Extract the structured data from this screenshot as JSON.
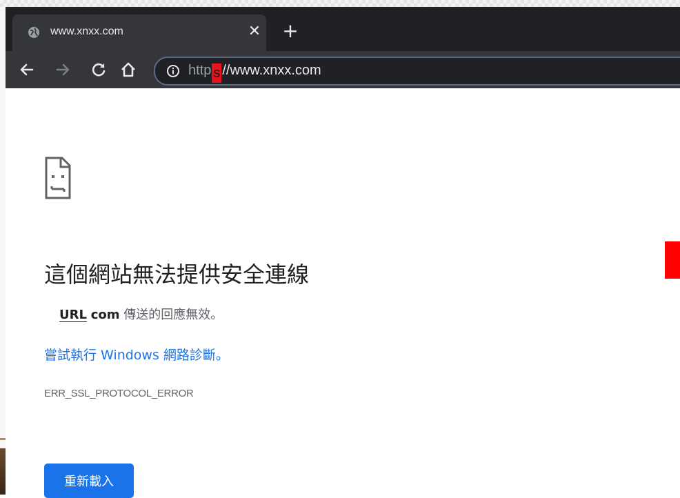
{
  "tab": {
    "title": "www.xnxx.com",
    "close_glyph": "✕",
    "new_tab_glyph": "+",
    "favicon": "globe-icon"
  },
  "toolbar": {
    "back_icon": "back-arrow-icon",
    "forward_icon": "forward-arrow-icon",
    "reload_icon": "reload-icon",
    "home_icon": "home-icon"
  },
  "omnibox": {
    "info_icon": "info-icon",
    "url_scheme_prefix": "http",
    "url_scheme_highlight": "s",
    "url_rest": "//www.xnxx.com",
    "highlight_color": "#e8121b"
  },
  "error_page": {
    "icon": "sad-page-icon",
    "heading": "這個網站無法提供安全連線",
    "sub_url_label": "URL",
    "sub_domain": "com",
    "sub_text": "傳送的回應無效。",
    "diagnostics_link": "嘗試執行 Windows 網路診斷。",
    "error_code": "ERR_SSL_PROTOCOL_ERROR",
    "reload_button": "重新載入"
  },
  "colors": {
    "tabstrip_bg": "#202124",
    "toolbar_bg": "#35363a",
    "link_blue": "#1a73e8",
    "button_blue": "#1a73e8",
    "annotation_red": "#ff0000"
  }
}
